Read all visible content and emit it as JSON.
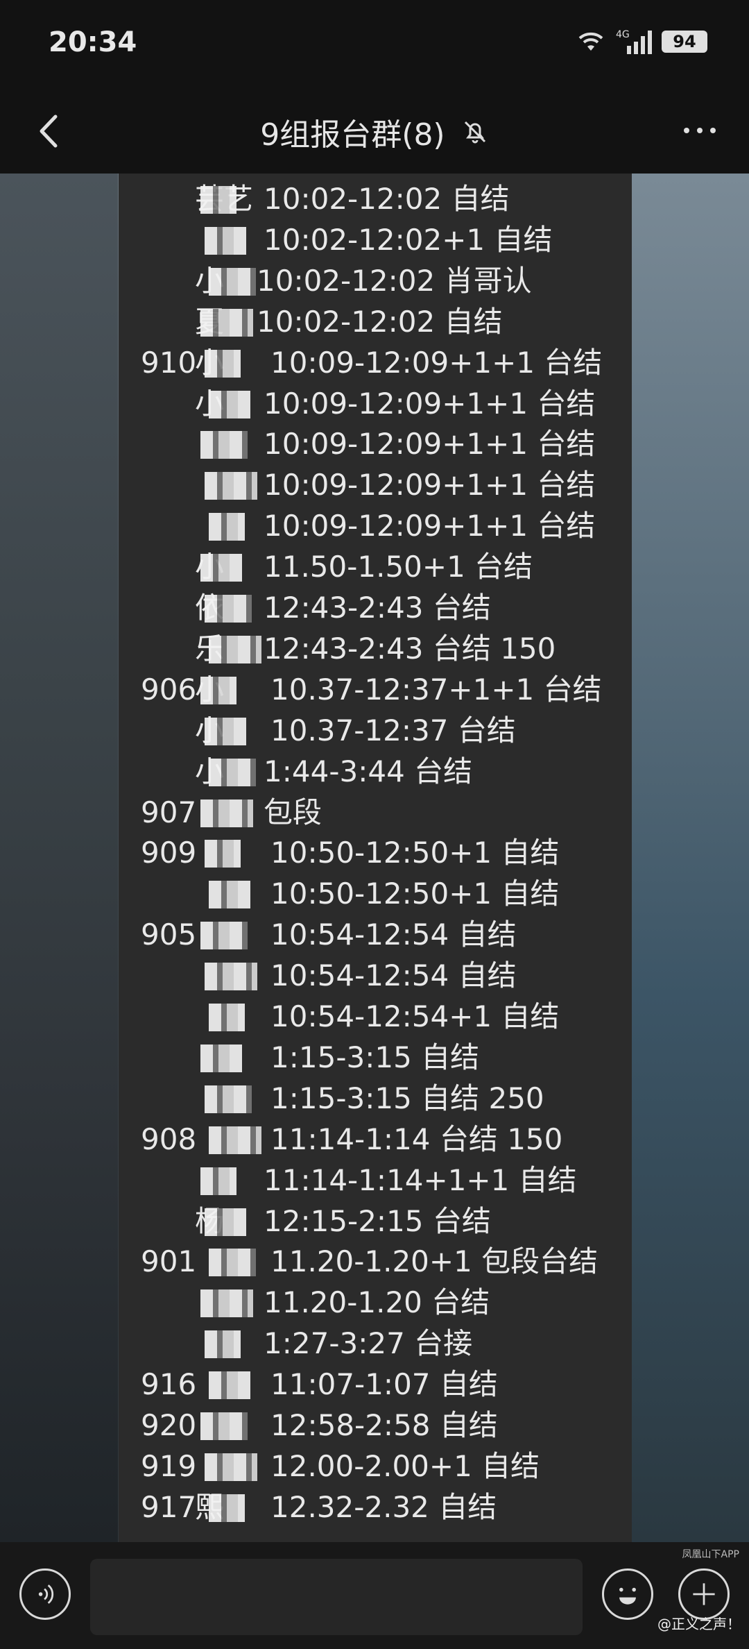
{
  "status_bar": {
    "time": "20:34",
    "network": "4G",
    "battery": "94"
  },
  "header": {
    "title": "9组报台群(8)"
  },
  "icons": {
    "back": "chevron-left-icon",
    "mute": "bell-off-icon",
    "more": "more-horizontal-icon",
    "voice": "voice-icon",
    "emoji": "emoji-icon",
    "plus": "plus-icon"
  },
  "messages": [
    {
      "room": "",
      "name": "芸艺",
      "time": "10:02-12:02 自结"
    },
    {
      "room": "",
      "name": "",
      "time": "10:02-12:02+1 自结"
    },
    {
      "room": "",
      "name": "小",
      "time": "10:02-12:02 肖哥认"
    },
    {
      "room": "",
      "name": "夏",
      "time": "10:02-12:02 自结"
    },
    {
      "room": "910",
      "name": "小",
      "time": "10:09-12:09+1+1 台结"
    },
    {
      "room": "",
      "name": "小",
      "time": "10:09-12:09+1+1 台结"
    },
    {
      "room": "",
      "name": "",
      "time": "10:09-12:09+1+1 台结"
    },
    {
      "room": "",
      "name": "",
      "time": "10:09-12:09+1+1 台结"
    },
    {
      "room": "",
      "name": "",
      "time": "10:09-12:09+1+1 台结"
    },
    {
      "room": "",
      "name": "小",
      "time": "11.50-1.50+1 台结"
    },
    {
      "room": "",
      "name": "依",
      "time": "12:43-2:43 台结"
    },
    {
      "room": "",
      "name": "乐",
      "time": "12:43-2:43 台结 150"
    },
    {
      "room": "906",
      "name": "小",
      "time": "10.37-12:37+1+1 台结"
    },
    {
      "room": "",
      "name": "小",
      "time": "10.37-12:37 台结"
    },
    {
      "room": "",
      "name": "小",
      "time": "1:44-3:44 台结"
    },
    {
      "room": "907",
      "name": "",
      "time": "包段"
    },
    {
      "room": "909",
      "name": "",
      "time": "10:50-12:50+1 自结"
    },
    {
      "room": "",
      "name": "",
      "time": "10:50-12:50+1 自结"
    },
    {
      "room": "905",
      "name": "",
      "time": "10:54-12:54 自结"
    },
    {
      "room": "",
      "name": "",
      "time": "10:54-12:54 自结"
    },
    {
      "room": "",
      "name": "",
      "time": "10:54-12:54+1 自结"
    },
    {
      "room": "",
      "name": "",
      "time": "1:15-3:15 自结"
    },
    {
      "room": "",
      "name": "",
      "time": "1:15-3:15 自结 250"
    },
    {
      "room": "908",
      "name": "",
      "time": "11:14-1:14 台结 150"
    },
    {
      "room": "",
      "name": "",
      "time": "11:14-1:14+1+1 自结"
    },
    {
      "room": "",
      "name": "杨",
      "time": "12:15-2:15 台结"
    },
    {
      "room": "901",
      "name": "",
      "time": "11.20-1.20+1 包段台结"
    },
    {
      "room": "",
      "name": "",
      "time": "11.20-1.20 台结"
    },
    {
      "room": "",
      "name": "",
      "time": "1:27-3:27 台接"
    },
    {
      "room": "916",
      "name": "",
      "time": "11:07-1:07 自结"
    },
    {
      "room": "920",
      "name": "",
      "time": "12:58-2:58 自结"
    },
    {
      "room": "919",
      "name": "",
      "time": "12.00-2.00+1 自结"
    },
    {
      "room": "917",
      "name": "熙",
      "time": "12.32-2.32 自结"
    }
  ],
  "watermark": {
    "line1": "凤凰山下APP",
    "line2": "@正义之声！"
  }
}
